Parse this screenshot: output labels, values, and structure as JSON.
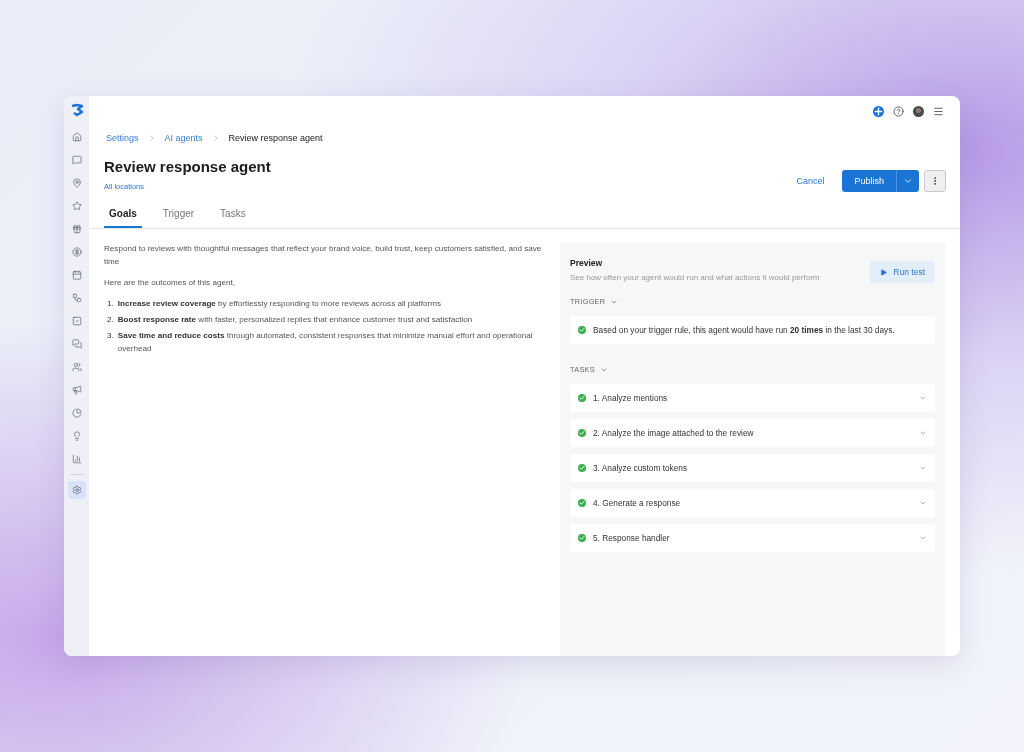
{
  "sidebar": {
    "items": [
      {
        "selected": false
      },
      {
        "selected": false
      },
      {
        "selected": false
      },
      {
        "selected": false
      },
      {
        "selected": false
      },
      {
        "selected": false
      },
      {
        "selected": false
      },
      {
        "selected": false
      },
      {
        "selected": false
      },
      {
        "selected": false
      },
      {
        "selected": false
      },
      {
        "selected": false
      },
      {
        "selected": false
      },
      {
        "selected": false
      },
      {
        "selected": false
      },
      {
        "selected": true
      }
    ]
  },
  "breadcrumb": [
    {
      "label": "Settings",
      "kind": "link"
    },
    {
      "label": "AI agents",
      "kind": "link"
    },
    {
      "label": "Review response agent",
      "kind": "current"
    }
  ],
  "header": {
    "title": "Review response agent",
    "subtitle": "All locations",
    "cancel": "Cancel",
    "publish": "Publish"
  },
  "tabs": [
    {
      "label": "Goals",
      "selected": true
    },
    {
      "label": "Trigger",
      "selected": false
    },
    {
      "label": "Tasks",
      "selected": false
    }
  ],
  "goals": {
    "intro": "Respond to reviews with thoughtful messages that reflect your brand voice, build trust, keep customers satisfied, and save time",
    "lead": "Here are the outcomes of this agent,",
    "outcomes": [
      {
        "number": "1.",
        "text": "**Increase review coverage** by effortlessly responding to more reviews across all platforms"
      },
      {
        "number": "2.",
        "text": "**Boost response rate** with faster, personalized replies that enhance customer trust and satisfaction"
      },
      {
        "number": "3.",
        "text": "**Save time and reduce costs** through automated, consistent responses that minimize manual effort and operational overhead"
      }
    ]
  },
  "preview": {
    "title": "Preview",
    "subtitle": "See how often your agent would run and what actions it would perform",
    "run_button": "Run test",
    "trigger": {
      "heading": "TRIGGER",
      "expanded": true,
      "message": "Based on your trigger rule, this agent would have run **20 times** in the last 30 days."
    },
    "tasks": {
      "heading": "TASKS",
      "expanded": true,
      "items": [
        {
          "label": "1. Analyze mentions",
          "completed": true
        },
        {
          "label": "2. Analyze the image attached to the review",
          "completed": true
        },
        {
          "label": "3. Analyze custom tokens",
          "completed": true
        },
        {
          "label": "4. Generate a response",
          "completed": true
        },
        {
          "label": "5. Response handler",
          "completed": true
        }
      ]
    }
  }
}
